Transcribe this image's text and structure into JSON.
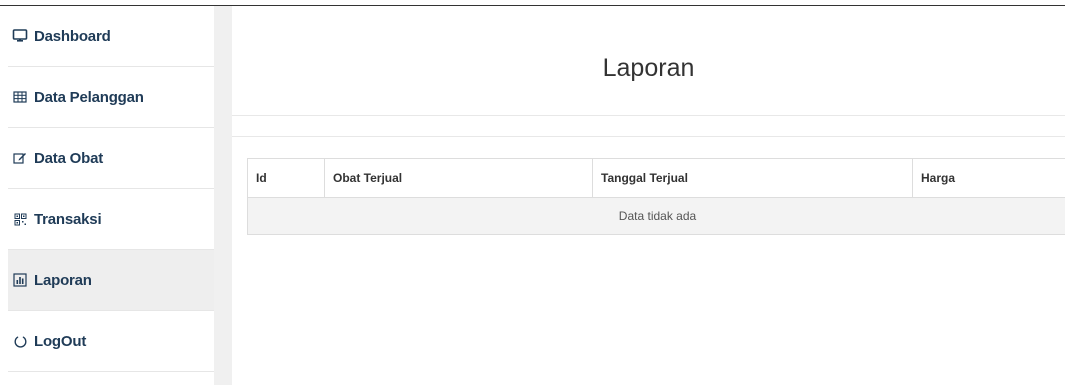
{
  "sidebar": {
    "items": [
      {
        "label": "Dashboard",
        "icon": "monitor-icon",
        "active": false
      },
      {
        "label": "Data Pelanggan",
        "icon": "table-icon",
        "active": false
      },
      {
        "label": "Data Obat",
        "icon": "edit-icon",
        "active": false
      },
      {
        "label": "Transaksi",
        "icon": "qrcode-icon",
        "active": false
      },
      {
        "label": "Laporan",
        "icon": "chart-icon",
        "active": true
      },
      {
        "label": "LogOut",
        "icon": "power-icon",
        "active": false
      }
    ]
  },
  "main": {
    "title": "Laporan",
    "table": {
      "headers": [
        "Id",
        "Obat Terjual",
        "Tanggal Terjual",
        "Harga"
      ],
      "empty_message": "Data tidak ada"
    }
  },
  "colors": {
    "nav_text": "#1f3b57",
    "active_bg": "#eeeeee",
    "gutter_bg": "#f0f0f0",
    "empty_row_bg": "#f3f3f3"
  }
}
